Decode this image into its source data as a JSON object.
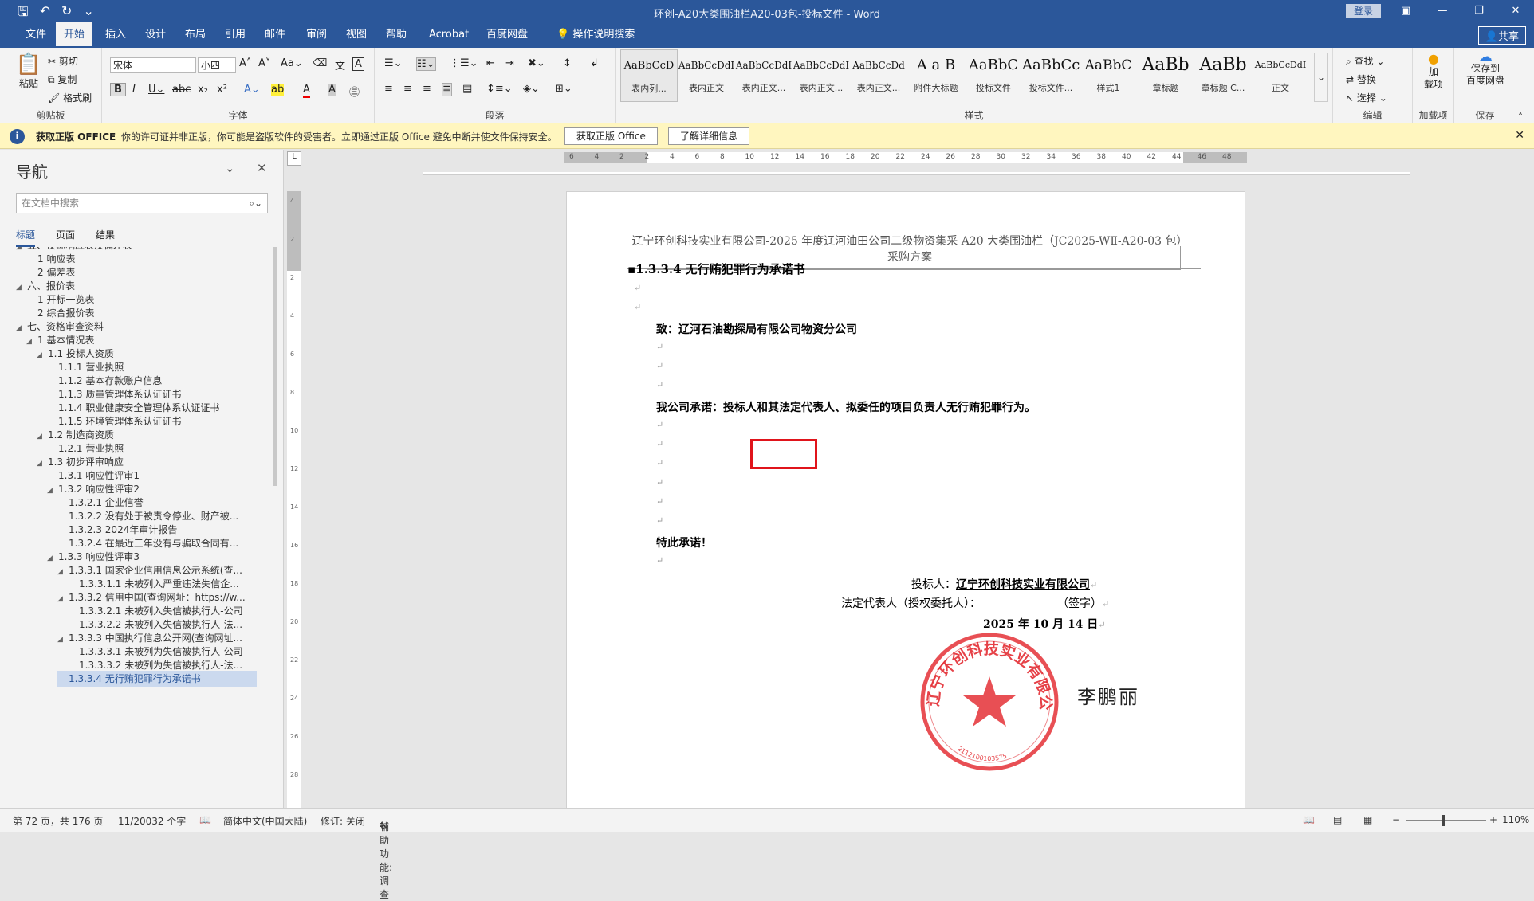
{
  "window": {
    "title": "环创-A20大类围油栏A20-03包-投标文件 - Word",
    "login": "登录"
  },
  "tabs": [
    "文件",
    "开始",
    "插入",
    "设计",
    "布局",
    "引用",
    "邮件",
    "审阅",
    "视图",
    "帮助",
    "Acrobat",
    "百度网盘",
    "操作说明搜索"
  ],
  "share": "共享",
  "ribbon": {
    "clipboard": {
      "paste": "粘贴",
      "cut": "剪切",
      "copy": "复制",
      "format": "格式刷",
      "label": "剪贴板"
    },
    "font": {
      "name": "宋体",
      "size": "小四",
      "label": "字体"
    },
    "paragraph": {
      "label": "段落"
    },
    "styles": {
      "label": "样式",
      "items": [
        {
          "preview": "AaBbCcD",
          "name": "表内列..."
        },
        {
          "preview": "AaBbCcDdI",
          "name": "表内正文"
        },
        {
          "preview": "AaBbCcDdI",
          "name": "表内正文..."
        },
        {
          "preview": "AaBbCcDdI",
          "name": "表内正文..."
        },
        {
          "preview": "AaBbCcDd",
          "name": "表内正文..."
        },
        {
          "preview": "A a B",
          "name": "附件大标题"
        },
        {
          "preview": "AaBbC",
          "name": "投标文件"
        },
        {
          "preview": "AaBbCc",
          "name": "投标文件..."
        },
        {
          "preview": "AaBbC",
          "name": "样式1"
        },
        {
          "preview": "AaBb",
          "name": "章标题"
        },
        {
          "preview": "AaBb",
          "name": "章标题 C..."
        },
        {
          "preview": "AaBbCcDdI",
          "name": "正文"
        }
      ]
    },
    "editing": {
      "find": "查找",
      "replace": "替换",
      "select": "选择",
      "label": "编辑"
    },
    "addins": {
      "btn": "加\n载项",
      "label": "加载项"
    },
    "save": {
      "btn": "保存到\n百度网盘",
      "label": "保存"
    }
  },
  "infobar": {
    "title": "获取正版 OFFICE",
    "text": "你的许可证并非正版，你可能是盗版软件的受害者。立即通过正版 Office 避免中断并使文件保持安全。",
    "btn1": "获取正版 Office",
    "btn2": "了解详细信息"
  },
  "nav": {
    "title": "导航",
    "search_placeholder": "在文档中搜索",
    "tabs": [
      "标题",
      "页面",
      "结果"
    ],
    "items": [
      {
        "text": "五、投标响应表及偏差表",
        "level": 0,
        "tri": "◢"
      },
      {
        "text": "1 响应表",
        "level": 1,
        "tri": ""
      },
      {
        "text": "2 偏差表",
        "level": 1,
        "tri": ""
      },
      {
        "text": "六、报价表",
        "level": 0,
        "tri": "◢"
      },
      {
        "text": "1 开标一览表",
        "level": 1,
        "tri": ""
      },
      {
        "text": "2 综合报价表",
        "level": 1,
        "tri": ""
      },
      {
        "text": "七、资格审查资料",
        "level": 0,
        "tri": "◢"
      },
      {
        "text": "1 基本情况表",
        "level": 1,
        "tri": "◢"
      },
      {
        "text": "1.1 投标人资质",
        "level": 2,
        "tri": "◢"
      },
      {
        "text": "1.1.1 营业执照",
        "level": 3,
        "tri": ""
      },
      {
        "text": "1.1.2 基本存款账户信息",
        "level": 3,
        "tri": ""
      },
      {
        "text": "1.1.3 质量管理体系认证证书",
        "level": 3,
        "tri": ""
      },
      {
        "text": "1.1.4 职业健康安全管理体系认证证书",
        "level": 3,
        "tri": ""
      },
      {
        "text": "1.1.5 环境管理体系认证证书",
        "level": 3,
        "tri": ""
      },
      {
        "text": "1.2 制造商资质",
        "level": 2,
        "tri": "◢"
      },
      {
        "text": "1.2.1 营业执照",
        "level": 3,
        "tri": ""
      },
      {
        "text": "1.3 初步评审响应",
        "level": 2,
        "tri": "◢"
      },
      {
        "text": "1.3.1 响应性评审1",
        "level": 3,
        "tri": ""
      },
      {
        "text": "1.3.2 响应性评审2",
        "level": 3,
        "tri": "◢"
      },
      {
        "text": "1.3.2.1 企业信誉",
        "level": 4,
        "tri": ""
      },
      {
        "text": "1.3.2.2 没有处于被责令停业、财产被...",
        "level": 4,
        "tri": ""
      },
      {
        "text": "1.3.2.3 2024年审计报告",
        "level": 4,
        "tri": ""
      },
      {
        "text": "1.3.2.4 在最近三年没有与骗取合同有...",
        "level": 4,
        "tri": ""
      },
      {
        "text": "1.3.3 响应性评审3",
        "level": 3,
        "tri": "◢"
      },
      {
        "text": "1.3.3.1 国家企业信用信息公示系统(查...",
        "level": 4,
        "tri": "◢"
      },
      {
        "text": "1.3.3.1.1 未被列入严重违法失信企...",
        "level": 5,
        "tri": ""
      },
      {
        "text": "1.3.3.2 信用中国(查询网址：https://w...",
        "level": 4,
        "tri": "◢"
      },
      {
        "text": "1.3.3.2.1 未被列入失信被执行人-公司",
        "level": 5,
        "tri": ""
      },
      {
        "text": "1.3.3.2.2 未被列入失信被执行人-法...",
        "level": 5,
        "tri": ""
      },
      {
        "text": "1.3.3.3 中国执行信息公开网(查询网址...",
        "level": 4,
        "tri": "◢"
      },
      {
        "text": "1.3.3.3.1 未被列为失信被执行人-公司",
        "level": 5,
        "tri": ""
      },
      {
        "text": "1.3.3.3.2 未被列为失信被执行人-法...",
        "level": 5,
        "tri": ""
      },
      {
        "text": "1.3.3.4 无行贿犯罪行为承诺书",
        "level": 4,
        "tri": "",
        "current": true
      }
    ]
  },
  "ruler": {
    "h": [
      "6",
      "4",
      "2",
      "2",
      "4",
      "6",
      "8",
      "10",
      "12",
      "14",
      "16",
      "18",
      "20",
      "22",
      "24",
      "26",
      "28",
      "30",
      "32",
      "34",
      "36",
      "38",
      "40",
      "42",
      "44",
      "46",
      "48"
    ],
    "v": [
      "4",
      "2",
      "2",
      "4",
      "6",
      "8",
      "10",
      "12",
      "14",
      "16",
      "18",
      "20",
      "22",
      "24",
      "26",
      "28"
    ]
  },
  "document": {
    "header": "辽宁环创科技实业有限公司-2025 年度辽河油田公司二级物资集采 A20 大类围油栏（JC2025-WⅡ-A20-03 包）采购方案",
    "heading": "▪1.3.3.4  无行贿犯罪行为承诺书",
    "to": "致：辽河石油勘探局有限公司物资分公司",
    "promise": "我公司承诺：投标人和其法定代表人、拟委任的项目负责人无行贿犯罪行为。",
    "closing": "特此承诺！",
    "bidder_label": "投标人：",
    "bidder": "辽宁环创科技实业有限公司",
    "rep_label": "法定代表人（授权委托人）：",
    "sign": "李鹏丽",
    "sign_note": "（签字）",
    "date": "2025 年 10 月 14 日",
    "stamp_text": "辽宁环创科技实业有限公司",
    "stamp_code": "2112100103575"
  },
  "status": {
    "page": "第 72 页，共 176 页",
    "words": "11/20032 个字",
    "lang": "简体中文(中国大陆)",
    "track": "修订: 关闭",
    "access": "辅助功能: 调查",
    "zoom": "110%"
  },
  "colors": {
    "accent": "#2b579a",
    "infobar": "#fff6bf",
    "stamp": "#e0141b"
  }
}
